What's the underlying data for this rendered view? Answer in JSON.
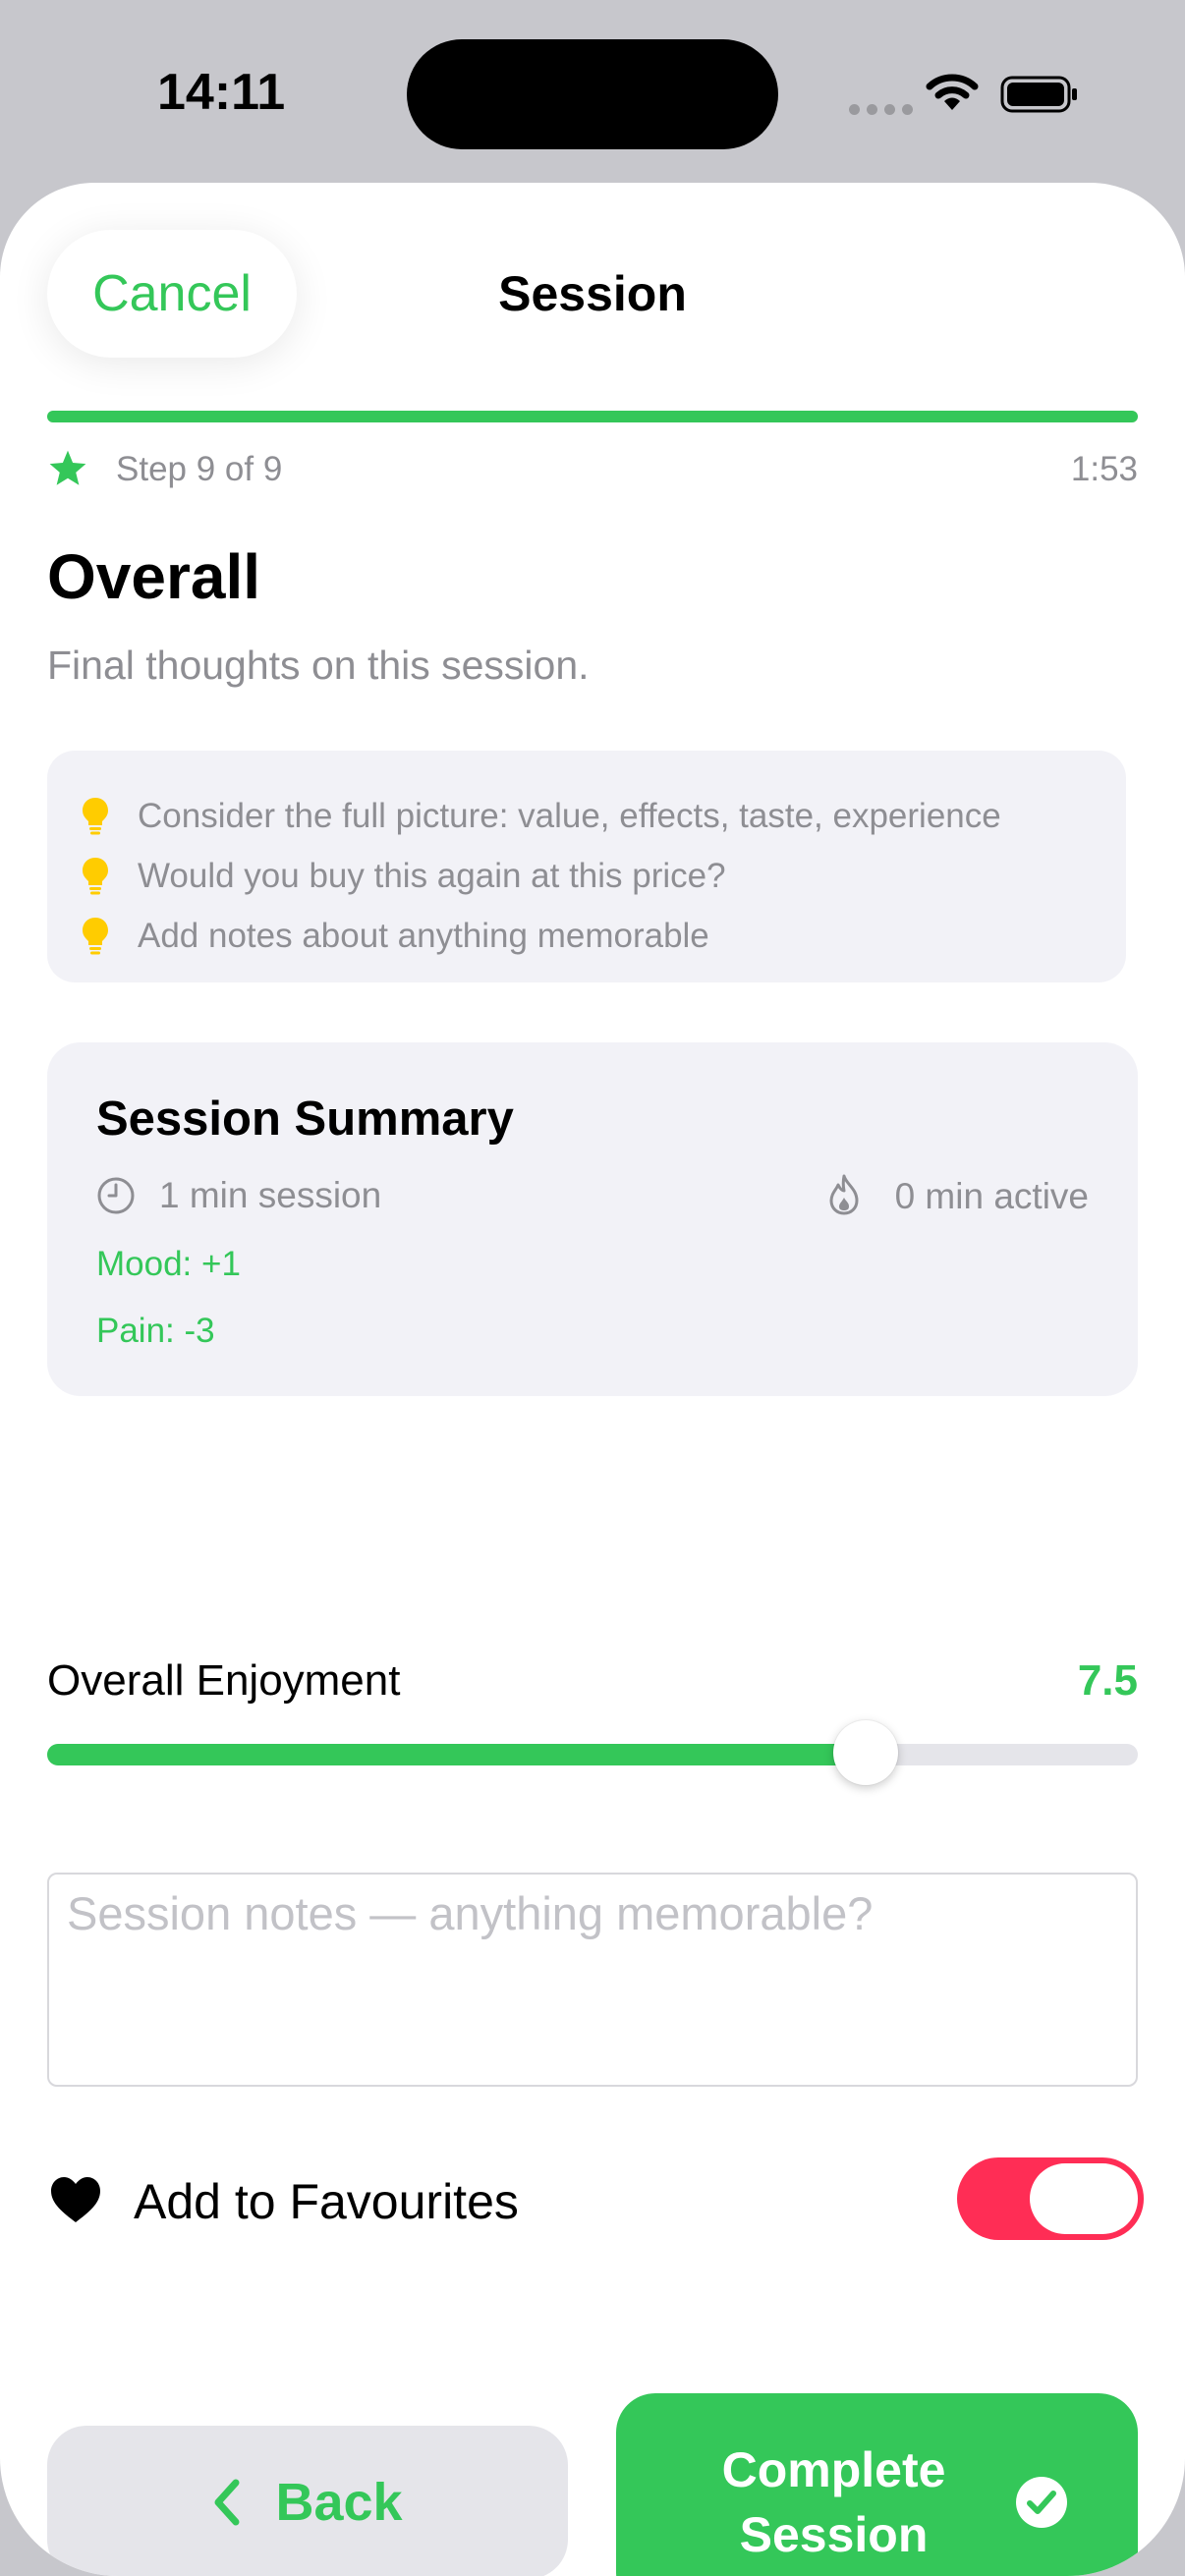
{
  "status_bar": {
    "time": "14:11"
  },
  "nav": {
    "cancel_label": "Cancel",
    "title": "Session"
  },
  "progress": {
    "fraction": 1.0,
    "step_label": "Step 9 of 9",
    "elapsed": "1:53"
  },
  "page": {
    "title": "Overall",
    "subtitle": "Final thoughts on this session."
  },
  "tips": [
    "Consider the full picture: value, effects, taste, experience",
    "Would you buy this again at this price?",
    "Add notes about anything memorable"
  ],
  "summary": {
    "title": "Session Summary",
    "duration": "1 min session",
    "active": "0 min active",
    "mood": "Mood: +1",
    "pain": "Pain: -3"
  },
  "enjoyment": {
    "label": "Overall Enjoyment",
    "value_text": "7.5",
    "value": 7.5,
    "min": 0,
    "max": 10
  },
  "notes": {
    "placeholder": "Session notes — anything memorable?",
    "value": ""
  },
  "favourite": {
    "label": "Add to Favourites",
    "enabled": true
  },
  "actions": {
    "back_label": "Back",
    "complete_label": "Complete Session"
  },
  "colors": {
    "accent": "#34c759",
    "toggle_on": "#ff2d55",
    "tip_icon": "#ffcc00",
    "secondary_text": "#8e8e93"
  },
  "icons": {
    "step": "star-icon",
    "tip": "lightbulb-icon",
    "duration": "clock-icon",
    "active": "flame-icon",
    "favourite": "heart-icon",
    "back": "chevron-left-icon",
    "complete": "checkmark-circle-icon"
  }
}
